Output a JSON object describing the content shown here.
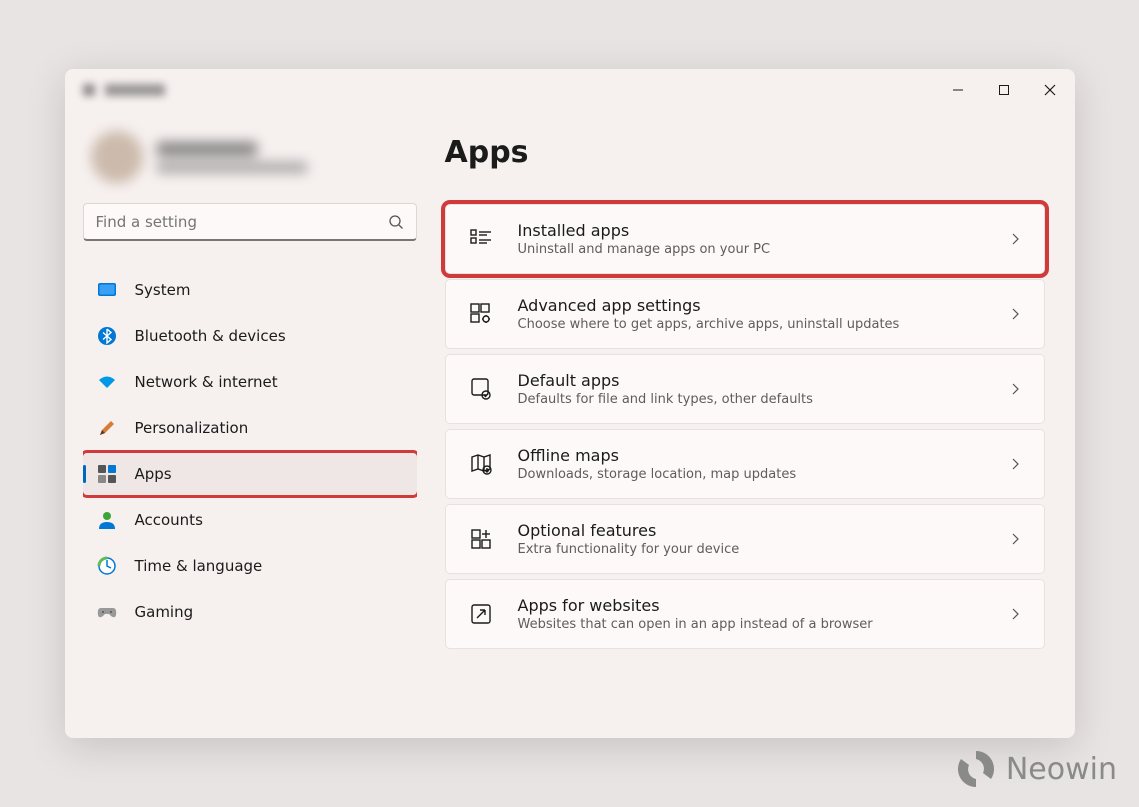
{
  "search": {
    "placeholder": "Find a setting"
  },
  "sidebar": {
    "items": [
      {
        "label": "System"
      },
      {
        "label": "Bluetooth & devices"
      },
      {
        "label": "Network & internet"
      },
      {
        "label": "Personalization"
      },
      {
        "label": "Apps"
      },
      {
        "label": "Accounts"
      },
      {
        "label": "Time & language"
      },
      {
        "label": "Gaming"
      }
    ]
  },
  "page": {
    "title": "Apps",
    "cards": [
      {
        "title": "Installed apps",
        "desc": "Uninstall and manage apps on your PC"
      },
      {
        "title": "Advanced app settings",
        "desc": "Choose where to get apps, archive apps, uninstall updates"
      },
      {
        "title": "Default apps",
        "desc": "Defaults for file and link types, other defaults"
      },
      {
        "title": "Offline maps",
        "desc": "Downloads, storage location, map updates"
      },
      {
        "title": "Optional features",
        "desc": "Extra functionality for your device"
      },
      {
        "title": "Apps for websites",
        "desc": "Websites that can open in an app instead of a browser"
      }
    ]
  },
  "watermark": "Neowin"
}
